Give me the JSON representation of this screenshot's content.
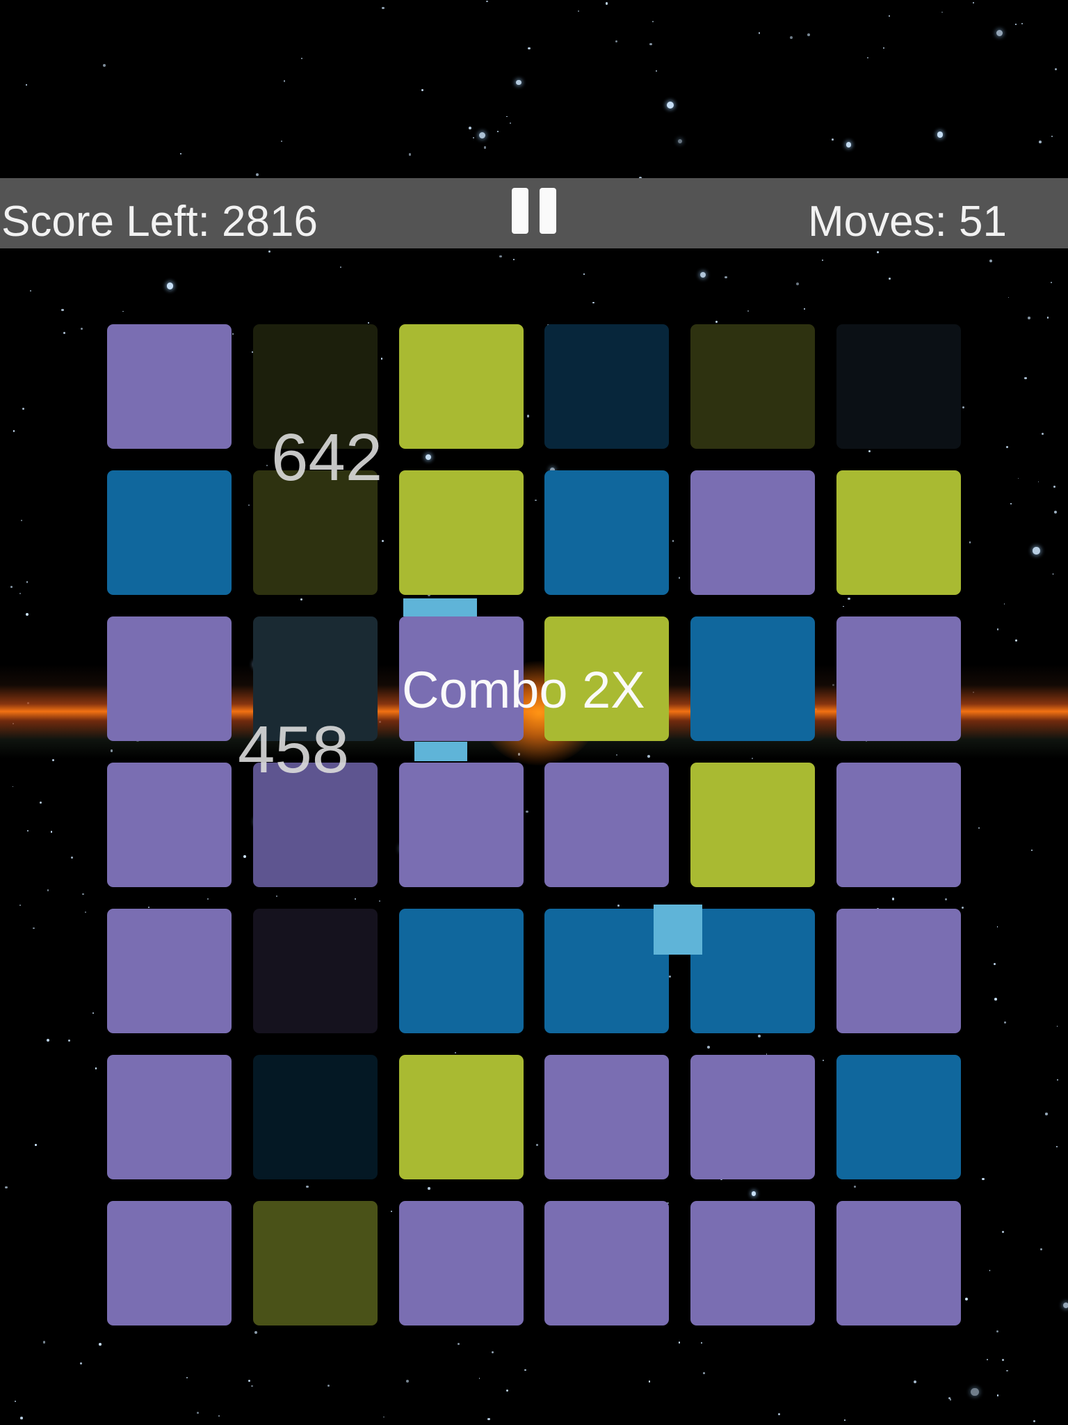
{
  "hud": {
    "score_left": "Score Left: 2816",
    "moves": "Moves: 51",
    "pause_icon": "pause-icon"
  },
  "popups": {
    "score_a": "642",
    "score_b": "458",
    "combo": "Combo 2X"
  },
  "colors": {
    "purple": "#7a6eb2",
    "lime": "#a9ba32",
    "blue": "#10679d",
    "hud_bar": "#545454",
    "link": "#5fb4d8",
    "nebula": "#ff7a14"
  },
  "board": {
    "columns": 6,
    "rows": 7,
    "tiles": [
      [
        "purple",
        "dim-dark-olive",
        "lime",
        "dim-navy",
        "dim-olive",
        "dim-charcoal"
      ],
      [
        "blue",
        "dim-olive",
        "lime",
        "blue",
        "purple",
        "lime"
      ],
      [
        "purple",
        "dim-slate",
        "purple",
        "lime",
        "blue",
        "purple"
      ],
      [
        "purple",
        "dim-purple",
        "purple",
        "purple",
        "lime",
        "purple"
      ],
      [
        "purple",
        "dim-plum",
        "blue",
        "blue",
        "blue",
        "purple"
      ],
      [
        "purple",
        "dim-navy-deep",
        "lime",
        "purple",
        "purple",
        "blue"
      ],
      [
        "purple",
        "dim-olive-green",
        "purple",
        "purple",
        "purple",
        "purple"
      ]
    ]
  }
}
